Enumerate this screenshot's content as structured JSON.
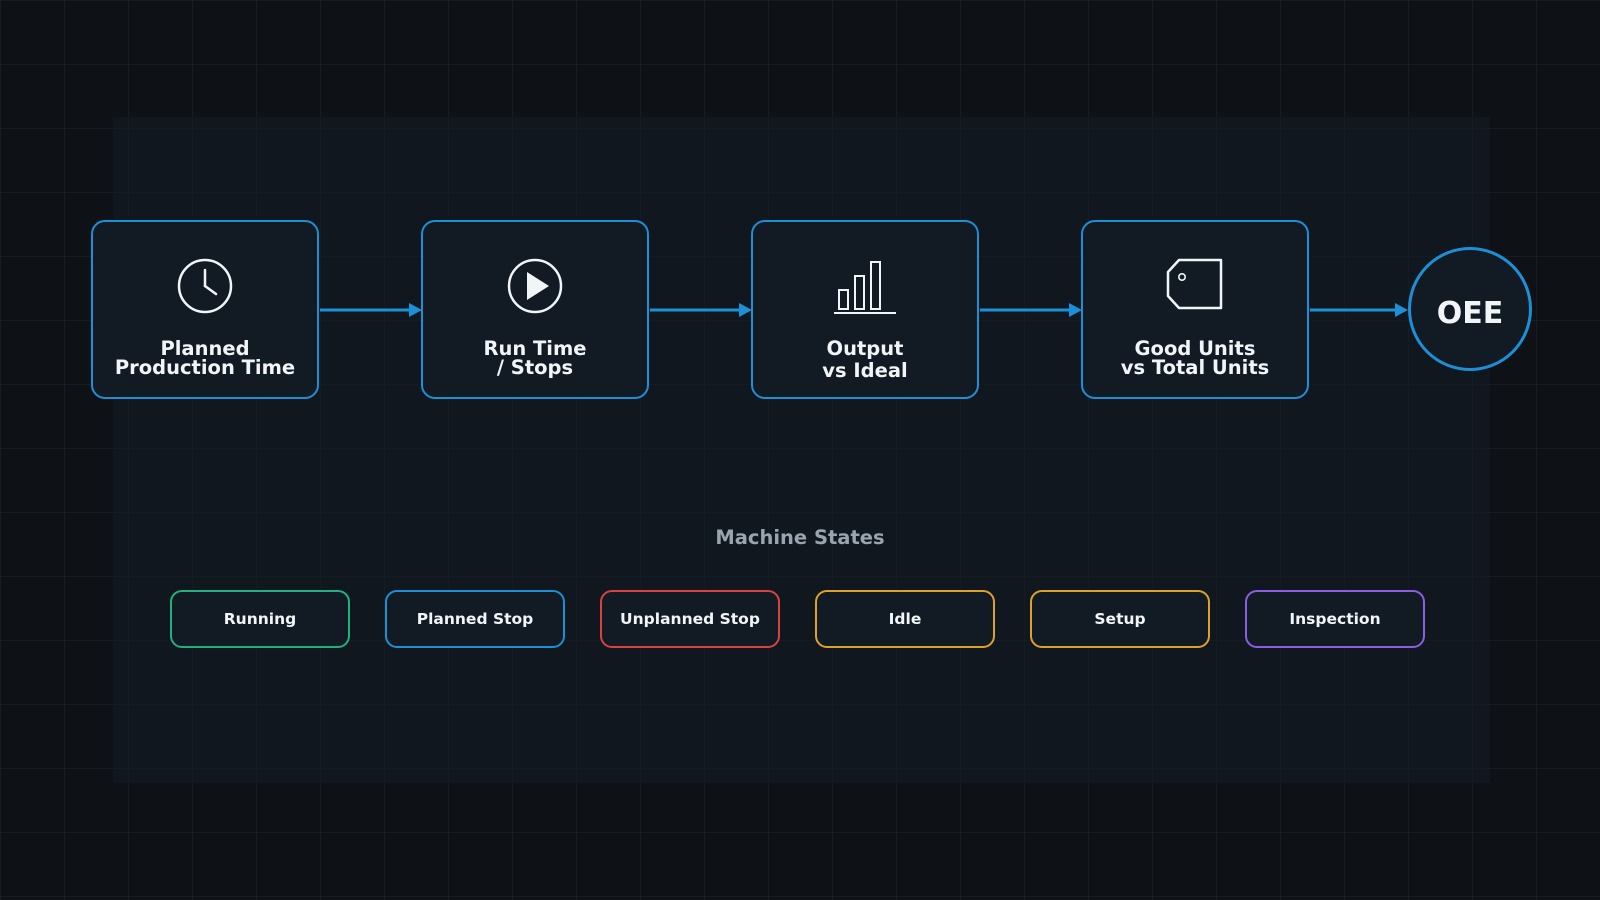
{
  "colors": {
    "accent": "#1d8fd6",
    "background": "#0e1217",
    "node_fill": "#121a24",
    "text": "#f2f5f8",
    "muted_text": "#9aa4ae"
  },
  "flow": {
    "nodes": [
      {
        "id": "planned-production-time",
        "icon": "clock-icon",
        "label_lines": [
          "Planned",
          "Production Time"
        ]
      },
      {
        "id": "run-time-stops",
        "icon": "play-icon",
        "label_lines": [
          "Run Time",
          "/ Stops"
        ]
      },
      {
        "id": "output-vs-ideal",
        "icon": "bar-chart-icon",
        "label_lines": [
          "Output",
          "vs Ideal"
        ]
      },
      {
        "id": "good-units-vs-total-units",
        "icon": "tag-icon",
        "label_lines": [
          "Good Units",
          "vs Total Units"
        ]
      }
    ],
    "result": {
      "label": "OEE"
    }
  },
  "machine_states": {
    "title": "Machine States",
    "states": [
      {
        "label": "Running",
        "color": "#22b07d"
      },
      {
        "label": "Planned Stop",
        "color": "#1d8fd6"
      },
      {
        "label": "Unplanned Stop",
        "color": "#d8423f"
      },
      {
        "label": "Idle",
        "color": "#e0a12a"
      },
      {
        "label": "Setup",
        "color": "#e0a12a"
      },
      {
        "label": "Inspection",
        "color": "#8a5fe0"
      }
    ]
  }
}
